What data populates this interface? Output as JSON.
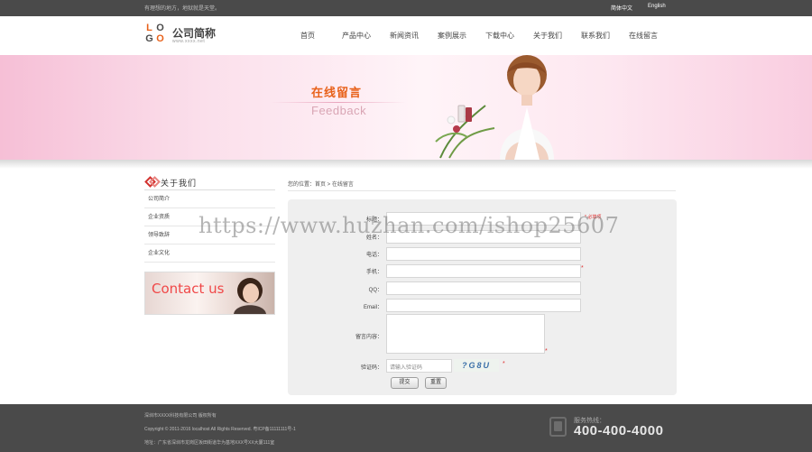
{
  "topbar": {
    "slogan": "有理想的地方，地狱就是天堂。",
    "lang_cn": "简体中文",
    "lang_en": "English"
  },
  "logo": {
    "letters": [
      "L",
      "O",
      "G",
      "O"
    ],
    "name": "公司简称",
    "url": "www.xxxx.net",
    "colors": [
      "#e8611a",
      "#4a4a4a",
      "#4a4a4a",
      "#e8611a"
    ]
  },
  "nav": [
    "首页",
    "产品中心",
    "新闻资讯",
    "案例展示",
    "下载中心",
    "关于我们",
    "联系我们",
    "在线留言"
  ],
  "banner": {
    "title": "在线留言",
    "subtitle": "Feedback"
  },
  "sidebar": {
    "title": "关于我们",
    "items": [
      "公司简介",
      "企业资质",
      "领导致辞",
      "企业文化"
    ],
    "contact_text": "Contact us"
  },
  "breadcrumb": "您的位置：首页 > 在线留言",
  "form": {
    "fields": [
      {
        "label": "标题：",
        "value": "",
        "required": true,
        "note": "* 必填项"
      },
      {
        "label": "姓名：",
        "value": "",
        "required": false,
        "note": ""
      },
      {
        "label": "电话：",
        "value": "",
        "required": false,
        "note": ""
      },
      {
        "label": "手机：",
        "value": "",
        "required": true,
        "note": "*"
      },
      {
        "label": "QQ：",
        "value": "",
        "required": false,
        "note": ""
      },
      {
        "label": "Email：",
        "value": "",
        "required": false,
        "note": ""
      }
    ],
    "content_label": "留言内容：",
    "content_note": "*",
    "captcha_label": "验证码：",
    "captcha_placeholder": "请输入验证码",
    "captcha_text": "?G8U",
    "captcha_note": "*",
    "submit_label": "提交",
    "reset_label": "重置"
  },
  "watermark": "https://www.huzhan.com/ishop25607",
  "footer": {
    "line1": "深圳市XXXX科技有限公司 版权所有",
    "line2": "Copyright © 2011-2016  localhost All Rights Reserved. 粤ICP备11111111号-1",
    "line3": "地址：广东省深圳市龙岗区坂田街道华为基地XXX号XX大厦111室",
    "hotline_label": "服务热线：",
    "hotline_number": "400-400-4000"
  }
}
